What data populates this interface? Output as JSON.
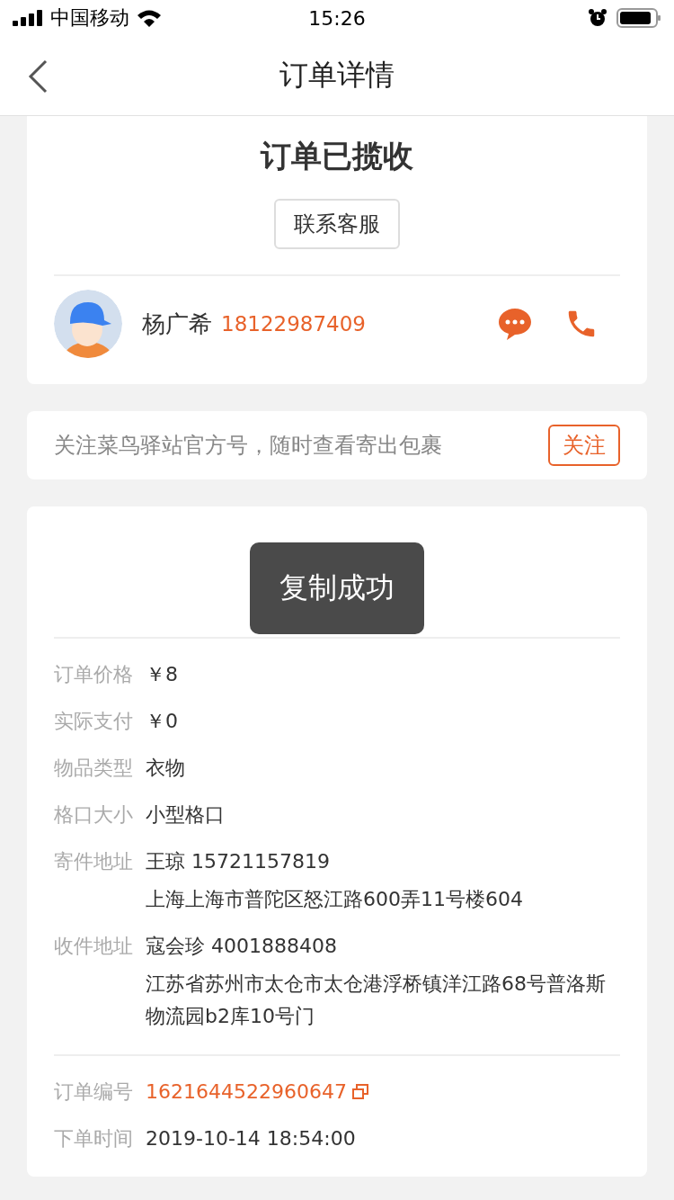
{
  "status_bar": {
    "carrier": "中国移动",
    "time": "15:26"
  },
  "nav": {
    "title": "订单详情"
  },
  "order_status": {
    "title": "订单已揽收",
    "contact_button": "联系客服"
  },
  "courier": {
    "name": "杨广希",
    "phone": "18122987409"
  },
  "follow_banner": {
    "text": "关注菜鸟驿站官方号，随时查看寄出包裹",
    "button": "关注"
  },
  "toast": {
    "text": "复制成功"
  },
  "details": [
    {
      "kind": "text",
      "label": "订单价格",
      "lines": [
        "￥8"
      ]
    },
    {
      "kind": "text",
      "label": "实际支付",
      "lines": [
        "￥0"
      ]
    },
    {
      "kind": "text",
      "label": "物品类型",
      "lines": [
        "衣物"
      ]
    },
    {
      "kind": "text",
      "label": "格口大小",
      "lines": [
        "小型格口"
      ]
    },
    {
      "kind": "text",
      "label": "寄件地址",
      "lines": [
        "王琼 15721157819",
        "上海上海市普陀区怒江路600弄11号楼604"
      ]
    },
    {
      "kind": "text",
      "label": "收件地址",
      "lines": [
        "寇会珍 4001888408",
        "江苏省苏州市太仓市太仓港浮桥镇洋江路68号普洛斯物流园b2库10号门"
      ]
    }
  ],
  "order_meta": [
    {
      "kind": "copyable",
      "label": "订单编号",
      "lines": [
        "1621644522960647"
      ]
    },
    {
      "kind": "text",
      "label": "下单时间",
      "lines": [
        "2019-10-14 18:54:00"
      ]
    }
  ]
}
